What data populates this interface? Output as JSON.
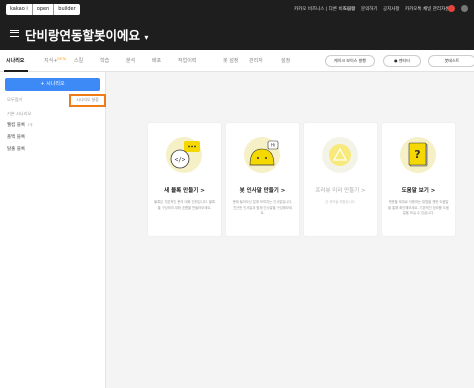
{
  "brand": {
    "left": "kakao i",
    "mid": "open",
    "right": "builder"
  },
  "topnav": {
    "items": [
      "카카오 비즈니스 | 다른 비즈니스",
      "도움말",
      "문의하기",
      "공지사항",
      "카카오톡 채널 관리자센터"
    ]
  },
  "header": {
    "bot_name": "단비랑연동할봇이에요",
    "dropdown_glyph": "▾"
  },
  "tabs": {
    "items": [
      "시나리오",
      "지식+",
      "스킬",
      "학습",
      "분석",
      "배포",
      "작업이력",
      "봇 설정",
      "관리자",
      "설정"
    ],
    "beta_badge": "BETA",
    "active": "시나리오"
  },
  "tab_actions": {
    "voice_button": "케이크 보이스 발행",
    "preview_button": "● 멘티터",
    "deploy_button": "봇테스트"
  },
  "sidebar": {
    "add_button": "+ 시나리오",
    "section_label": "모두접기",
    "folder_button": "시나리오 설정",
    "group_label": "기본 시나리오",
    "items": [
      {
        "label": "웰컴 블록",
        "count": "1개"
      },
      {
        "label": "폴백 블록",
        "count": ""
      },
      {
        "label": "탈출 블록",
        "count": ""
      }
    ]
  },
  "cards": [
    {
      "title": "새 블록 만들기 >",
      "desc": "블록은 기본적인 봇의 대화 단위입니다. 블록을 구성하여 대화 흐름을 만들어보세요.",
      "icon": "code-speech-icon",
      "disabled": false
    },
    {
      "title": "봇 인사말 만들기 >",
      "desc": "봇에 들어오신 분께 보여지는 인사말입니다. 친근한 인사말과 함께 인사말을 구성해보세요.",
      "icon": "chatbot-face-icon",
      "disabled": false
    },
    {
      "title": "프리뷰 미리 만들기 >",
      "desc": "곧 준비될 예정입니다.",
      "icon": "lightbulb-triangle-icon",
      "disabled": true
    },
    {
      "title": "도움말 보기 >",
      "desc": "챗봇을 제대로 이용하는 방법을 챗봇 도움말을 통해 확인해보세요. 기본적인 정보를 도움말을 보실 수 있습니다.",
      "icon": "question-book-icon",
      "disabled": false
    }
  ],
  "colors": {
    "header_bg": "#1e1e1e",
    "accent_blue": "#3d8af7",
    "highlight_orange": "#f07c16",
    "icon_yellow": "#f5d800"
  }
}
